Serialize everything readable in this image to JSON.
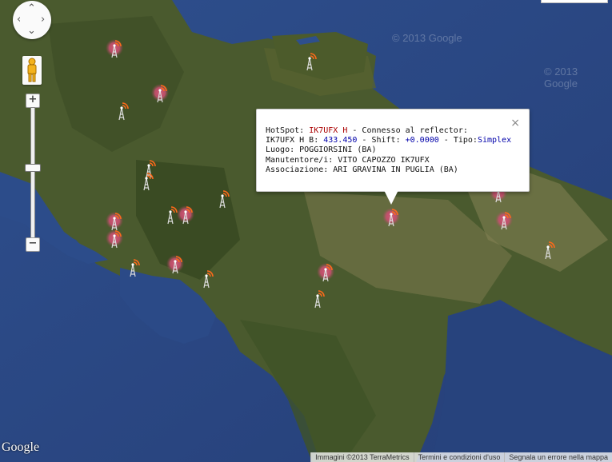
{
  "map": {
    "land_color": "#4d5c2f",
    "sea_color": "#2b4a86",
    "markers": [
      {
        "kind": "active"
      },
      {
        "kind": "tower"
      },
      {
        "kind": "tower"
      },
      {
        "kind": "active"
      },
      {
        "kind": "tower"
      },
      {
        "kind": "tower"
      },
      {
        "kind": "tower"
      },
      {
        "kind": "tower"
      },
      {
        "kind": "active"
      },
      {
        "kind": "active"
      },
      {
        "kind": "active"
      },
      {
        "kind": "tower"
      },
      {
        "kind": "active"
      },
      {
        "kind": "tower"
      },
      {
        "kind": "active"
      },
      {
        "kind": "tower"
      },
      {
        "kind": "active"
      },
      {
        "kind": "active"
      },
      {
        "kind": "active"
      },
      {
        "kind": "tower"
      }
    ]
  },
  "controls": {
    "zoom_in": "+",
    "zoom_out": "−",
    "pan_icon": "pan-compass-icon",
    "pegman_icon": "pegman-icon",
    "zoom_level_fraction": 0.54
  },
  "popup": {
    "line1_label": "HotSpot: ",
    "callsign": "IK7UFX H",
    "line1_status": " - Connesso al reflector:",
    "line2_prefix": "IK7UFX H B: ",
    "frequency": "433.450",
    "line2_shift_label": " - Shift: ",
    "shift": "+0.0000",
    "line2_tipo_label": " - Tipo:",
    "tipo": "Simplex",
    "luogo": "Luogo: POGGIORSINI (BA)",
    "manutentore": "Manutentore/i: VITO CAPOZZO IK7UFX",
    "associazione": "Associazione: ARI GRAVINA IN PUGLIA (BA)",
    "close": "×"
  },
  "footer": {
    "imagery": "Immagini ©2013 TerraMetrics",
    "terms": "Termini e condizioni d'uso",
    "report": "Segnala un errore nella mappa"
  },
  "branding": {
    "google_logo": "Google",
    "watermarks": [
      "© 2013 Google",
      "© 2013 Google"
    ]
  }
}
